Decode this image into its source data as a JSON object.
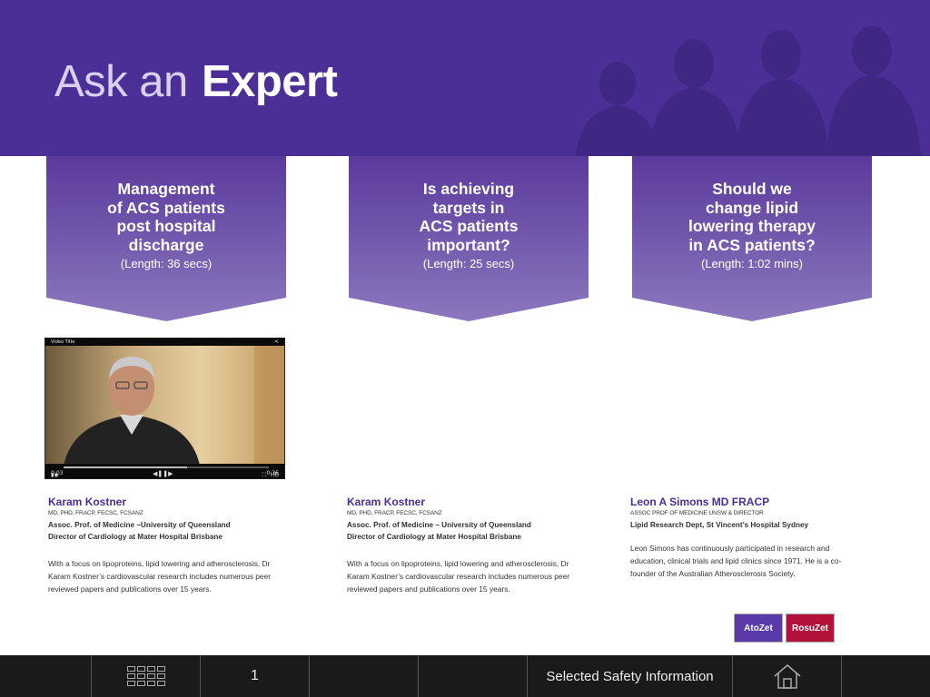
{
  "header": {
    "title_light": "Ask an",
    "title_bold": "Expert"
  },
  "videos": [
    {
      "question": "Management\nof ACS patients\npost hospital\ndischarge",
      "length": "(Length: 36 secs)"
    },
    {
      "question": "Is achieving\ntargets in\nACS patients\nimportant?",
      "length": "(Length: 25 secs)"
    },
    {
      "question": "Should we\nchange lipid\nlowering therapy\nin ACS patients?",
      "length": "(Length: 1:02 mins)"
    }
  ],
  "player": {
    "video_title": "Video Title",
    "time_left": "0:03",
    "time_right": "0:36",
    "hd": "HD"
  },
  "experts": [
    {
      "name": "Karam Kostner",
      "credentials": "MD, PHD, FRACP, FECSC, FCSANZ",
      "role1": "Assoc. Prof. of Medicine –University of Queensland",
      "role2": "Director of Cardiology at Mater Hospital Brisbane",
      "bio": "With a focus on lipoproteins, lipid lowering and atherosclerosis, Dr Karam Kostner’s cardiovascular research includes numerous peer reviewed papers and publications over 15 years."
    },
    {
      "name": "Karam Kostner",
      "credentials": "MD, PHD, FRACP, FECSC, FCSANZ",
      "role1": "Assoc. Prof. of Medicine – University of Queensland",
      "role2": "Director of Cardiology at Mater Hospital Brisbane",
      "bio": "With a focus on lipoproteins, lipid lowering and atherosclerosis, Dr Karam Kostner’s cardiovascular research includes numerous peer reviewed papers and publications over 15 years."
    },
    {
      "name": "Leon A Simons MD FRACP",
      "credentials": "ASSOC PROF OF MEDICINE UNSW & DIRECTOR",
      "role1": "Lipid Research Dept, St Vincent’s Hospital Sydney",
      "role2": "",
      "bio": "Leon Simons has continuously participated in research and education, clinical trials and lipid clinics since 1971. He is a co-founder of the Australian Atherosclerosis Society."
    }
  ],
  "logos": {
    "atozet": "AtoZet",
    "rosuzet": "RosuZet"
  },
  "footer": {
    "page_number": "1",
    "safety_label": "Selected Safety Information"
  },
  "colors": {
    "brand_purple": "#4b2e96",
    "footer_bg": "#1a1a1a"
  }
}
